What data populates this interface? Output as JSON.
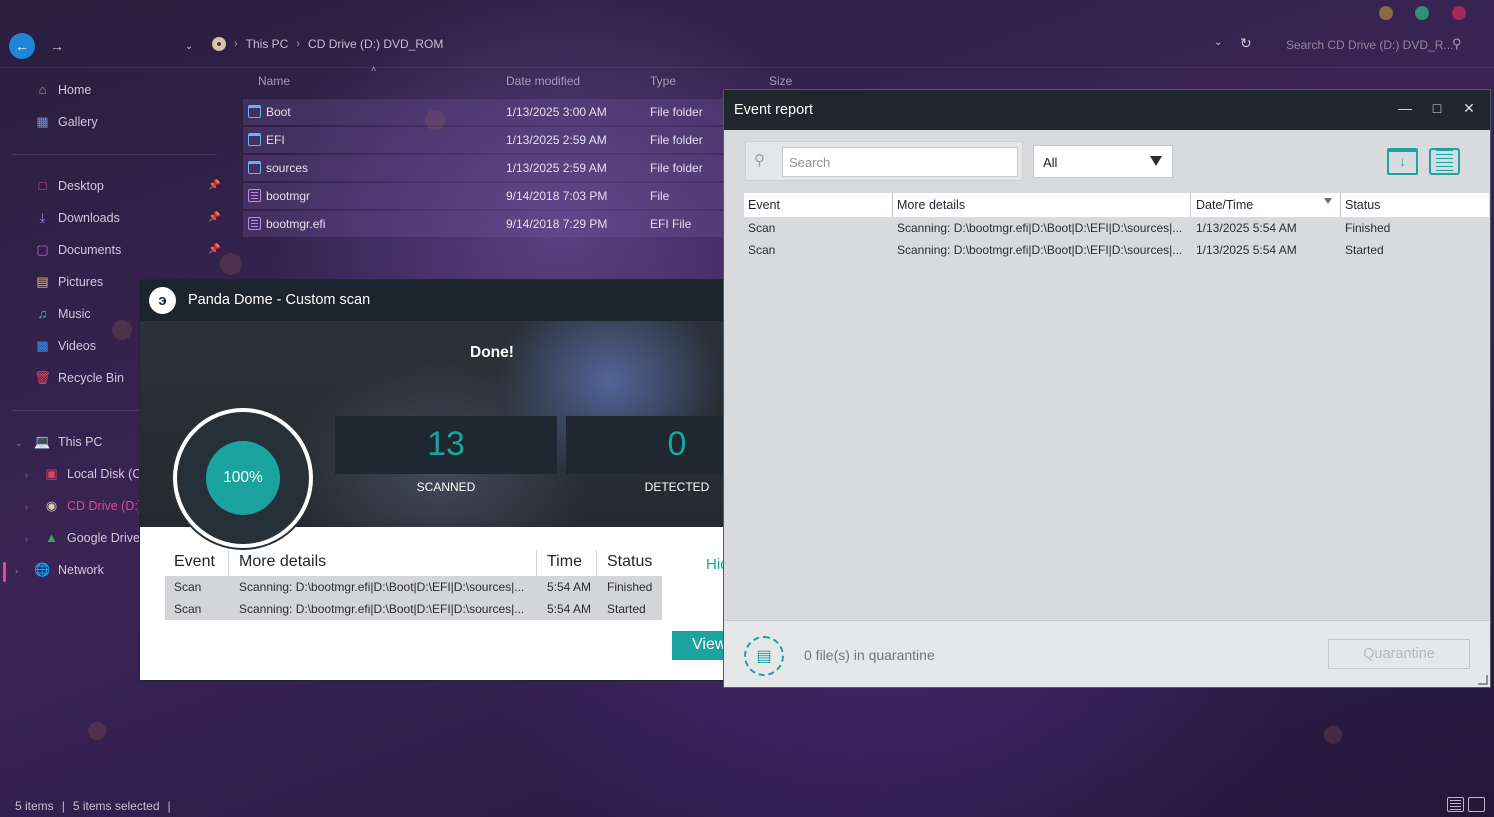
{
  "explorer": {
    "breadcrumb": [
      "This PC",
      "CD Drive (D:) DVD_ROM"
    ],
    "search_placeholder": "Search CD Drive (D:) DVD_R...",
    "columns": {
      "name": "Name",
      "date": "Date modified",
      "type": "Type",
      "size": "Size"
    },
    "files": [
      {
        "name": "Boot",
        "date": "1/13/2025 3:00 AM",
        "type": "File folder",
        "icon": "folder-icon"
      },
      {
        "name": "EFI",
        "date": "1/13/2025 2:59 AM",
        "type": "File folder",
        "icon": "folder-icon"
      },
      {
        "name": "sources",
        "date": "1/13/2025 2:59 AM",
        "type": "File folder",
        "icon": "folder-icon"
      },
      {
        "name": "bootmgr",
        "date": "9/14/2018 7:03 PM",
        "type": "File",
        "icon": "file-icon"
      },
      {
        "name": "bootmgr.efi",
        "date": "9/14/2018 7:29 PM",
        "type": "EFI File",
        "icon": "file-icon"
      }
    ],
    "sidebar": {
      "home": "Home",
      "gallery": "Gallery",
      "pinned": [
        "Desktop",
        "Downloads",
        "Documents"
      ],
      "others": [
        "Pictures",
        "Music",
        "Videos",
        "Recycle Bin"
      ],
      "this_pc": "This PC",
      "drives": [
        "Local Disk (C:)",
        "CD Drive (D:) D",
        "Google Drive ("
      ],
      "network": "Network"
    },
    "status": {
      "items": "5 items",
      "selected": "5 items selected"
    },
    "accent": "#e0489a"
  },
  "panda": {
    "title": "Panda Dome - Custom scan",
    "done": "Done!",
    "progress": "100%",
    "scanned_value": "13",
    "scanned_label": "SCANNED",
    "detected_value": "0",
    "detected_label": "DETECTED",
    "columns": {
      "event": "Event",
      "details": "More details",
      "time": "Time",
      "status": "Status"
    },
    "rows": [
      {
        "event": "Scan",
        "details": "Scanning: D:\\bootmgr.efi|D:\\Boot|D:\\EFI|D:\\sources|...",
        "time": "5:54 AM",
        "status": "Finished"
      },
      {
        "event": "Scan",
        "details": "Scanning: D:\\bootmgr.efi|D:\\Boot|D:\\EFI|D:\\sources|...",
        "time": "5:54 AM",
        "status": "Started"
      }
    ],
    "hide_link": "Hid",
    "view_button": "View",
    "accent": "#1aa39f"
  },
  "event_report": {
    "title": "Event report",
    "search_placeholder": "Search",
    "filter_value": "All",
    "columns": {
      "event": "Event",
      "details": "More details",
      "datetime": "Date/Time",
      "status": "Status"
    },
    "rows": [
      {
        "event": "Scan",
        "details": "Scanning: D:\\bootmgr.efi|D:\\Boot|D:\\EFI|D:\\sources|...",
        "datetime": "1/13/2025 5:54 AM",
        "status": "Finished"
      },
      {
        "event": "Scan",
        "details": "Scanning: D:\\bootmgr.efi|D:\\Boot|D:\\EFI|D:\\sources|...",
        "datetime": "1/13/2025 5:54 AM",
        "status": "Started"
      }
    ],
    "quarantine_text": "0 file(s) in quarantine",
    "quarantine_button": "Quarantine"
  }
}
